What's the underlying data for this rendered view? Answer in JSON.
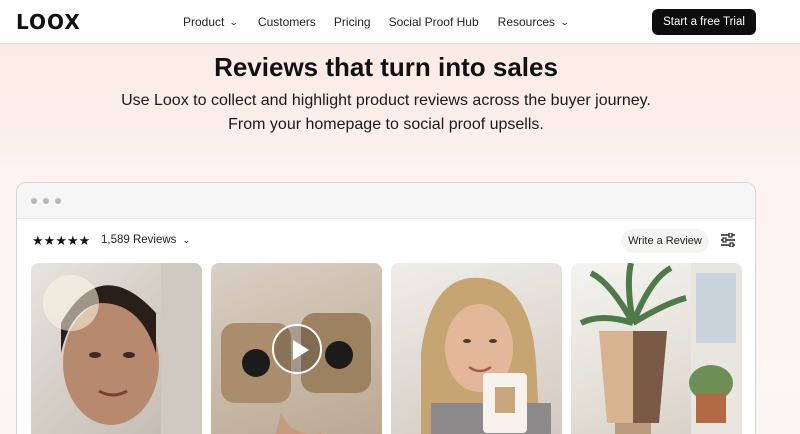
{
  "header": {
    "logo": "LOOX",
    "nav": [
      {
        "label": "Product",
        "has_dropdown": true
      },
      {
        "label": "Customers",
        "has_dropdown": false
      },
      {
        "label": "Pricing",
        "has_dropdown": false
      },
      {
        "label": "Social Proof Hub",
        "has_dropdown": false
      },
      {
        "label": "Resources",
        "has_dropdown": true
      }
    ],
    "cta_label": "Start a free Trial"
  },
  "hero": {
    "title": "Reviews that turn into sales",
    "subtitle_line1": "Use Loox to collect and highlight product reviews across the buyer journey.",
    "subtitle_line2": "From your homepage to social proof upsells."
  },
  "widget": {
    "rating_stars": 5,
    "review_count": "1,589 Reviews",
    "write_review_label": "Write a Review",
    "cards": [
      {
        "icon": "photo-woman-portrait"
      },
      {
        "icon": "video-packages",
        "has_play_button": true
      },
      {
        "icon": "photo-woman-mug"
      },
      {
        "icon": "photo-plant-pot"
      }
    ]
  },
  "colors": {
    "cta_bg": "#0d0d0d",
    "hero_bg": "#fbe9e5"
  }
}
